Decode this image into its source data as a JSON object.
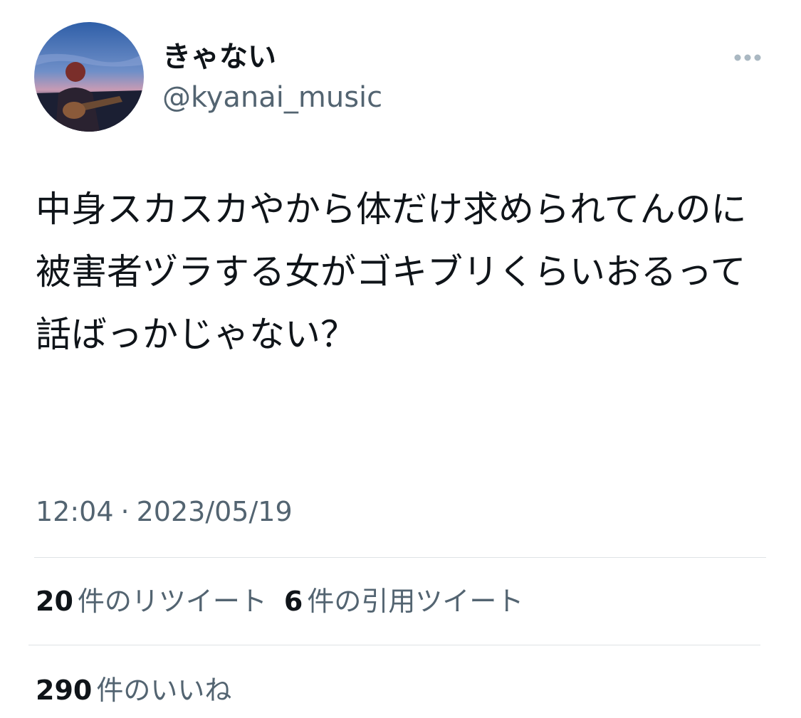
{
  "user": {
    "display_name": "きゃない",
    "handle": "@kyanai_music",
    "avatar_icon": "profile-photo-guitarist"
  },
  "menu": {
    "icon": "more-options-icon"
  },
  "tweet": {
    "text": "中身スカスカやから体だけ求められてんのに被害者ヅラする女がゴキブリくらいおるって話ばっかじゃない？"
  },
  "meta": {
    "time": "12:04",
    "separator": "·",
    "date": "2023/05/19"
  },
  "stats": {
    "retweets_count": "20",
    "retweets_label": "件のリツイート",
    "quotes_count": "6",
    "quotes_label": "件の引用ツイート",
    "likes_count": "290",
    "likes_label": "件のいいね"
  },
  "colors": {
    "text_primary": "#0f1419",
    "text_secondary": "#536471",
    "divider": "#dfe3e6"
  }
}
